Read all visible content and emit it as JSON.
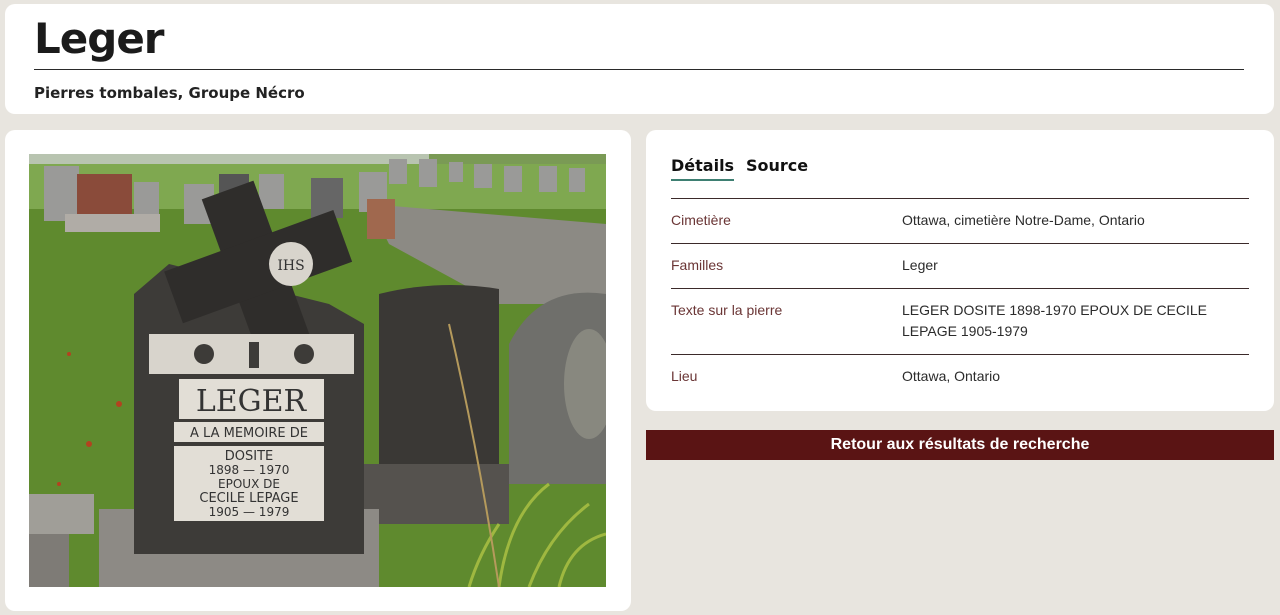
{
  "header": {
    "title": "Leger",
    "subtitle": "Pierres tombales, Groupe Nécro"
  },
  "photo": {
    "subject": "tombstone-photo",
    "stone_text": {
      "name": "LEGER",
      "line1": "A LA MEMOIRE DE",
      "line2": "DOSITE",
      "line3": "1898 — 1970",
      "line4": "EPOUX DE",
      "line5": "CECILE LEPAGE",
      "line6": "1905 — 1979",
      "medallion": "IHS"
    }
  },
  "details": {
    "tabs": [
      {
        "label": "Détails",
        "active": true
      },
      {
        "label": "Source",
        "active": false
      }
    ],
    "rows": [
      {
        "label": "Cimetière",
        "value": "Ottawa, cimetière Notre-Dame, Ontario"
      },
      {
        "label": "Familles",
        "value": "Leger"
      },
      {
        "label": "Texte sur la pierre",
        "value": "LEGER DOSITE 1898-1970 EPOUX DE CECILE LEPAGE 1905-1979"
      },
      {
        "label": "Lieu",
        "value": "Ottawa, Ontario"
      }
    ]
  },
  "back_button": {
    "label": "Retour aux résultats de recherche"
  },
  "colors": {
    "background": "#e8e5df",
    "accent_tab": "#3e7f72",
    "label_color": "#6a3535",
    "button_bg": "#5a1414"
  }
}
